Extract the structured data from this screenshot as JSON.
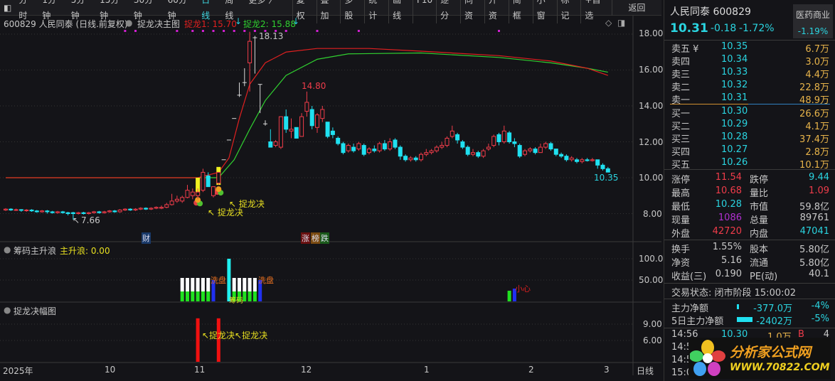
{
  "toolbar": {
    "left": [
      "分时",
      "1分钟",
      "5分钟",
      "15分钟",
      "30分钟",
      "60分钟",
      "日线",
      "周线",
      "更多 〉"
    ],
    "active": "日线",
    "right": [
      "复权",
      "叠加",
      "多股",
      "统计",
      "画线",
      "F10",
      "逐分",
      "同资",
      "开资",
      "简框",
      "小窗",
      "标记",
      "+自选"
    ],
    "back": "返回"
  },
  "main": {
    "title": "600829 人民同泰 (日线.前复权)",
    "indicator": "捉龙决主图",
    "l1": "捉龙1: 15.70",
    "l2": "捉龙2: 15.88",
    "high_label": "18.13",
    "low_label": "7.66",
    "peak_label": "14.80",
    "last_label": "10.35",
    "signal1": "捉龙决",
    "signal2": "捉龙决",
    "tag_cai": "财",
    "tag_zhang": "涨",
    "tag_bang": "榜",
    "tag_die": "跌",
    "y_ticks": [
      "18.00",
      "16.00",
      "14.00",
      "12.00",
      "10.00",
      "8.00"
    ]
  },
  "sub1": {
    "title": "筹码主升浪",
    "value": "主升浪: 0.00",
    "y_ticks": [
      "100.0",
      "50.00"
    ],
    "label_wash1": "洗盘",
    "label_wash2": "洗盘",
    "label_chip": "筹码",
    "label_careful": "小心"
  },
  "sub2": {
    "title": "捉龙决幅图",
    "y_ticks": [
      "9.00",
      "6.00"
    ],
    "label": "↖捉龙决↖捉龙决"
  },
  "x_axis": {
    "labels": [
      "2025年",
      "10",
      "11",
      "12",
      "1",
      "2",
      "3"
    ],
    "period": "日线"
  },
  "chart_data": {
    "type": "candlestick",
    "candles": [
      [
        8.2,
        8.25,
        8.3,
        8.15
      ],
      [
        8.25,
        8.2,
        8.3,
        8.15
      ],
      [
        8.2,
        8.22,
        8.28,
        8.15
      ],
      [
        8.22,
        8.18,
        8.25,
        8.1
      ],
      [
        8.18,
        8.2,
        8.25,
        8.1
      ],
      [
        8.2,
        8.15,
        8.25,
        8.1
      ],
      [
        8.15,
        8.1,
        8.2,
        8.05
      ],
      [
        8.1,
        8.15,
        8.2,
        8.05
      ],
      [
        8.15,
        8.1,
        8.2,
        8.0
      ],
      [
        8.1,
        8.05,
        8.15,
        8.0
      ],
      [
        8.05,
        8.1,
        8.15,
        8.0
      ],
      [
        8.1,
        8.05,
        8.15,
        8.0
      ],
      [
        8.05,
        8.0,
        8.1,
        7.9
      ],
      [
        8.05,
        8.0,
        8.1,
        7.66
      ],
      [
        8.0,
        8.05,
        8.1,
        7.95
      ],
      [
        8.05,
        8.0,
        8.1,
        7.95
      ],
      [
        8.0,
        8.05,
        8.1,
        7.95
      ],
      [
        8.05,
        8.1,
        8.15,
        8.0
      ],
      [
        8.1,
        8.05,
        8.15,
        8.0
      ],
      [
        8.05,
        8.1,
        8.15,
        8.0
      ],
      [
        8.1,
        8.15,
        8.2,
        8.05
      ],
      [
        8.15,
        8.1,
        8.2,
        8.05
      ],
      [
        8.1,
        8.2,
        8.25,
        8.05
      ],
      [
        8.2,
        8.25,
        8.3,
        8.15
      ],
      [
        8.25,
        8.2,
        8.3,
        8.15
      ],
      [
        8.2,
        8.25,
        8.3,
        8.15
      ],
      [
        8.25,
        8.3,
        8.35,
        8.2
      ],
      [
        8.3,
        8.25,
        8.35,
        8.2
      ],
      [
        8.25,
        8.3,
        8.35,
        8.2
      ],
      [
        8.3,
        8.35,
        8.4,
        8.25
      ],
      [
        8.3,
        8.35,
        8.45,
        8.25
      ],
      [
        8.35,
        8.5,
        8.6,
        8.3
      ],
      [
        8.5,
        8.7,
        9.1,
        8.45
      ],
      [
        8.7,
        8.8,
        9.0,
        8.6
      ],
      [
        8.7,
        8.9,
        9.0,
        8.6
      ],
      [
        8.9,
        9.3,
        9.6,
        8.85
      ],
      [
        9.0,
        9.2,
        9.4,
        8.8
      ],
      [
        9.0,
        9.2,
        9.4,
        8.8
      ],
      [
        9.3,
        10.3,
        10.5,
        9.2
      ],
      [
        10.1,
        9.5,
        10.3,
        9.5
      ],
      [
        9.0,
        9.5,
        9.5,
        8.9
      ],
      [
        9.7,
        10.3,
        10.3,
        9.6
      ],
      [
        11.0,
        11.0,
        11.0,
        11.0
      ],
      [
        12.1,
        12.1,
        12.1,
        12.1
      ],
      [
        13.3,
        13.3,
        13.3,
        13.3
      ],
      [
        14.6,
        14.6,
        15.3,
        14.5
      ],
      [
        15.3,
        15.3,
        16.1,
        15.1
      ],
      [
        16.4,
        17.6,
        18.13,
        14.8
      ],
      [
        17.8,
        17.8,
        17.9,
        15.8
      ],
      [
        15.2,
        15.2,
        15.2,
        13.6
      ],
      [
        13.0,
        13.0,
        13.2,
        12.9
      ],
      [
        12.0,
        11.7,
        12.7,
        11.7
      ],
      [
        11.8,
        12.0,
        12.1,
        11.7
      ],
      [
        11.7,
        13.4,
        13.4,
        11.6
      ],
      [
        13.4,
        12.7,
        13.8,
        12.5
      ],
      [
        12.6,
        12.7,
        13.3,
        12.2
      ],
      [
        12.8,
        12.2,
        12.8,
        12.2
      ],
      [
        12.3,
        13.4,
        13.6,
        12.3
      ],
      [
        13.7,
        14.2,
        14.8,
        13.4
      ],
      [
        13.8,
        12.9,
        14.0,
        12.7
      ],
      [
        12.8,
        13.5,
        13.6,
        12.5
      ],
      [
        13.3,
        13.8,
        14.0,
        13.1
      ],
      [
        13.1,
        12.3,
        13.1,
        12.2
      ],
      [
        12.6,
        12.4,
        12.8,
        12.2
      ],
      [
        12.2,
        11.9,
        12.3,
        11.8
      ],
      [
        11.9,
        11.4,
        12.0,
        11.3
      ],
      [
        11.5,
        11.8,
        11.9,
        11.4
      ],
      [
        11.7,
        11.5,
        11.9,
        11.4
      ],
      [
        11.6,
        11.9,
        12.0,
        11.5
      ],
      [
        11.8,
        11.3,
        11.9,
        11.2
      ],
      [
        11.4,
        11.6,
        11.7,
        11.3
      ],
      [
        11.6,
        11.5,
        11.8,
        11.4
      ],
      [
        11.5,
        11.9,
        12.0,
        11.4
      ],
      [
        11.9,
        11.6,
        12.1,
        11.5
      ],
      [
        11.6,
        12.0,
        12.2,
        11.5
      ],
      [
        12.1,
        11.7,
        12.2,
        11.6
      ],
      [
        11.7,
        11.2,
        11.8,
        11.0
      ],
      [
        11.2,
        11.0,
        11.3,
        10.9
      ],
      [
        11.0,
        11.1,
        11.2,
        10.9
      ],
      [
        11.1,
        11.0,
        11.2,
        10.9
      ],
      [
        11.0,
        11.3,
        11.4,
        10.9
      ],
      [
        11.3,
        11.4,
        11.6,
        11.2
      ],
      [
        11.4,
        11.5,
        11.6,
        11.3
      ],
      [
        11.5,
        11.7,
        11.8,
        11.4
      ],
      [
        11.7,
        11.8,
        12.0,
        11.6
      ],
      [
        11.8,
        12.2,
        12.3,
        11.7
      ],
      [
        12.3,
        12.6,
        12.9,
        12.2
      ],
      [
        12.4,
        12.1,
        12.5,
        11.9
      ],
      [
        12.0,
        11.7,
        12.1,
        11.6
      ],
      [
        11.7,
        11.3,
        11.8,
        11.2
      ],
      [
        11.3,
        11.4,
        11.6,
        11.2
      ],
      [
        11.4,
        11.2,
        11.5,
        11.1
      ],
      [
        11.2,
        11.5,
        11.6,
        11.1
      ],
      [
        11.6,
        11.7,
        11.9,
        11.5
      ],
      [
        11.8,
        12.3,
        12.4,
        11.7
      ],
      [
        12.4,
        12.0,
        12.5,
        11.8
      ],
      [
        12.0,
        12.6,
        12.9,
        11.9
      ],
      [
        12.5,
        12.0,
        12.6,
        11.9
      ],
      [
        12.0,
        11.9,
        12.2,
        11.7
      ],
      [
        11.8,
        11.2,
        11.9,
        11.1
      ],
      [
        11.3,
        11.5,
        11.6,
        11.2
      ],
      [
        11.5,
        11.6,
        11.7,
        11.4
      ],
      [
        11.6,
        11.4,
        11.7,
        11.3
      ],
      [
        11.4,
        11.7,
        11.9,
        11.4
      ],
      [
        11.7,
        11.9,
        12.0,
        11.6
      ],
      [
        11.9,
        11.6,
        12.0,
        11.5
      ],
      [
        11.6,
        11.3,
        11.6,
        11.2
      ],
      [
        11.3,
        11.2,
        11.4,
        11.1
      ],
      [
        11.2,
        11.0,
        11.3,
        10.9
      ],
      [
        11.0,
        11.1,
        11.2,
        10.9
      ],
      [
        11.0,
        10.9,
        11.1,
        10.8
      ],
      [
        10.9,
        11.0,
        11.1,
        10.8
      ],
      [
        11.0,
        10.95,
        11.1,
        10.9
      ],
      [
        10.95,
        11.0,
        11.1,
        10.9
      ],
      [
        11.0,
        10.7,
        11.0,
        10.5
      ],
      [
        10.7,
        10.5,
        10.8,
        10.4
      ],
      [
        10.5,
        10.31,
        10.6,
        10.3
      ]
    ],
    "limit_up_indices": [
      42,
      43,
      44,
      45,
      46,
      48,
      49,
      50
    ],
    "signal_bars": [
      [
        37,
        9.0,
        10.0
      ],
      [
        41,
        9.6,
        10.6
      ]
    ],
    "line_red": [
      [
        0,
        10.0
      ],
      [
        37,
        10.0
      ],
      [
        41,
        10.3
      ],
      [
        43,
        11.1
      ],
      [
        45,
        13.3
      ],
      [
        47,
        15.2
      ],
      [
        50,
        16.4
      ],
      [
        54,
        17.0
      ],
      [
        60,
        17.2
      ],
      [
        70,
        17.2
      ],
      [
        80,
        17.05
      ],
      [
        95,
        16.8
      ],
      [
        105,
        16.5
      ],
      [
        112,
        16.1
      ],
      [
        116,
        15.7
      ]
    ],
    "line_green": [
      [
        0,
        10.0
      ],
      [
        41,
        10.0
      ],
      [
        44,
        11.0
      ],
      [
        47,
        12.7
      ],
      [
        50,
        14.3
      ],
      [
        54,
        15.7
      ],
      [
        60,
        16.6
      ],
      [
        66,
        16.9
      ],
      [
        80,
        16.95
      ],
      [
        95,
        16.7
      ],
      [
        105,
        16.4
      ],
      [
        112,
        16.1
      ],
      [
        116,
        15.88
      ]
    ],
    "dot_indices": [
      23,
      25,
      33,
      36,
      38,
      40,
      42,
      44,
      46,
      48,
      50,
      52,
      54,
      60,
      68,
      95
    ],
    "sub1_bars": [
      [
        34,
        55,
        "wg"
      ],
      [
        35,
        55,
        "wg"
      ],
      [
        36,
        55,
        "wg"
      ],
      [
        37,
        55,
        "wg"
      ],
      [
        38,
        55,
        "wg"
      ],
      [
        39,
        55,
        "wg"
      ],
      [
        40,
        50,
        "b"
      ],
      [
        43,
        100,
        "c"
      ],
      [
        44,
        55,
        "wg"
      ],
      [
        45,
        55,
        "wg"
      ],
      [
        46,
        55,
        "wg"
      ],
      [
        47,
        55,
        "wg"
      ],
      [
        48,
        55,
        "wg"
      ],
      [
        49,
        50,
        "b"
      ],
      [
        97,
        25,
        "g"
      ],
      [
        98,
        30,
        "b"
      ]
    ],
    "sub2_bars": [
      [
        37,
        10.0
      ],
      [
        41,
        10.0
      ]
    ],
    "ylim": [
      7.5,
      18.5
    ]
  },
  "quote": {
    "name": "人民同泰",
    "code": "600829",
    "price": "10.31",
    "change": "-0.18",
    "pct": "-1.72%",
    "sector": "医药商业",
    "sector_pct": "-1.19%"
  },
  "asks": [
    [
      "卖五 ¥",
      "10.35",
      "6.7万"
    ],
    [
      "卖四",
      "10.34",
      "3.0万"
    ],
    [
      "卖三",
      "10.33",
      "4.4万"
    ],
    [
      "卖二",
      "10.32",
      "22.8万"
    ],
    [
      "卖一",
      "10.31",
      "48.9万"
    ]
  ],
  "bids": [
    [
      "买一",
      "10.30",
      "26.6万"
    ],
    [
      "买二",
      "10.29",
      "4.1万"
    ],
    [
      "买三",
      "10.28",
      "37.4万"
    ],
    [
      "买四",
      "10.27",
      "2.8万"
    ],
    [
      "买五",
      "10.26",
      "10.1万"
    ]
  ],
  "stats": [
    [
      "涨停",
      "11.54",
      "跌停",
      "9.44"
    ],
    [
      "最高",
      "10.68",
      "量比",
      "1.09"
    ],
    [
      "最低",
      "10.28",
      "市值",
      "59.8亿"
    ],
    [
      "现量",
      "1086",
      "总量",
      "89761"
    ],
    [
      "外盘",
      "42720",
      "内盘",
      "47041"
    ]
  ],
  "stats2": [
    [
      "换手",
      "1.55%",
      "股本",
      "5.80亿"
    ],
    [
      "净资",
      "5.16",
      "流通",
      "5.80亿"
    ],
    [
      "收益(三)",
      "0.190",
      "PE(动)",
      "40.1"
    ]
  ],
  "status": "交易状态: 闭市阶段 15:00:02",
  "flow": [
    [
      "主力净额",
      "-377.0万",
      "-4%"
    ],
    [
      "5日主力净额",
      "-2402万",
      "-5%"
    ]
  ],
  "trades": [
    [
      "14:56",
      "10.30",
      "1.0万",
      "B",
      "4"
    ],
    [
      "14:5",
      "",
      "",
      "",
      ""
    ],
    [
      "14:5",
      "",
      "",
      "",
      ""
    ],
    [
      "15:0",
      "",
      "",
      "",
      ""
    ]
  ],
  "logo": {
    "cn": "分析家公式网",
    "url": "WWW.70822.COM"
  }
}
